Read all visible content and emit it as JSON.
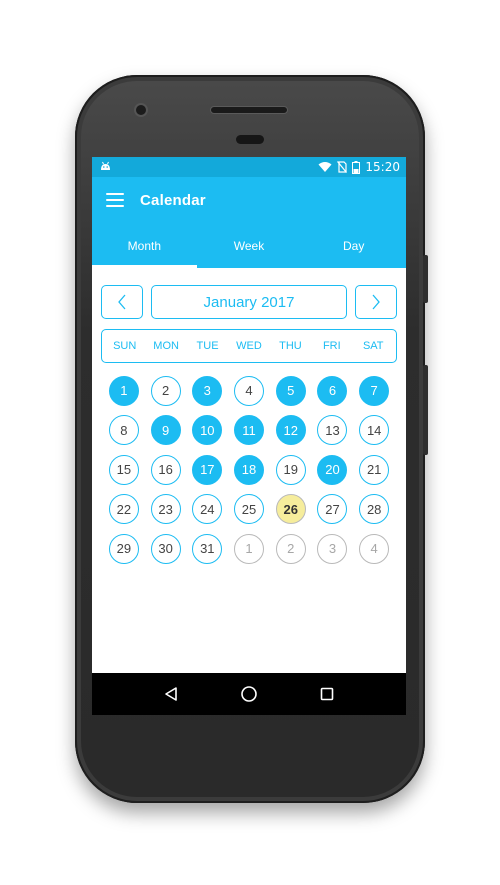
{
  "status_bar": {
    "time": "15:20",
    "icons": [
      "android-icon",
      "wifi-icon",
      "no-sim-icon",
      "battery-icon"
    ]
  },
  "app_bar": {
    "title": "Calendar",
    "menu_icon": "hamburger-menu-icon"
  },
  "tabs": [
    {
      "label": "Month",
      "active": true
    },
    {
      "label": "Week",
      "active": false
    },
    {
      "label": "Day",
      "active": false
    }
  ],
  "calendar": {
    "month_label": "January 2017",
    "prev_icon": "chevron-left-icon",
    "next_icon": "chevron-right-icon",
    "weekdays": [
      "SUN",
      "MON",
      "TUE",
      "WED",
      "THU",
      "FRI",
      "SAT"
    ],
    "weeks": [
      [
        {
          "d": "1",
          "s": "sel"
        },
        {
          "d": "2",
          "s": "normal"
        },
        {
          "d": "3",
          "s": "sel"
        },
        {
          "d": "4",
          "s": "normal"
        },
        {
          "d": "5",
          "s": "sel"
        },
        {
          "d": "6",
          "s": "sel"
        },
        {
          "d": "7",
          "s": "sel"
        }
      ],
      [
        {
          "d": "8",
          "s": "normal"
        },
        {
          "d": "9",
          "s": "sel"
        },
        {
          "d": "10",
          "s": "sel"
        },
        {
          "d": "11",
          "s": "sel"
        },
        {
          "d": "12",
          "s": "sel"
        },
        {
          "d": "13",
          "s": "normal"
        },
        {
          "d": "14",
          "s": "normal"
        }
      ],
      [
        {
          "d": "15",
          "s": "normal"
        },
        {
          "d": "16",
          "s": "normal"
        },
        {
          "d": "17",
          "s": "sel"
        },
        {
          "d": "18",
          "s": "sel"
        },
        {
          "d": "19",
          "s": "normal"
        },
        {
          "d": "20",
          "s": "sel"
        },
        {
          "d": "21",
          "s": "normal"
        }
      ],
      [
        {
          "d": "22",
          "s": "normal"
        },
        {
          "d": "23",
          "s": "normal"
        },
        {
          "d": "24",
          "s": "normal"
        },
        {
          "d": "25",
          "s": "normal"
        },
        {
          "d": "26",
          "s": "today"
        },
        {
          "d": "27",
          "s": "normal"
        },
        {
          "d": "28",
          "s": "normal"
        }
      ],
      [
        {
          "d": "29",
          "s": "normal"
        },
        {
          "d": "30",
          "s": "normal"
        },
        {
          "d": "31",
          "s": "normal"
        },
        {
          "d": "1",
          "s": "other"
        },
        {
          "d": "2",
          "s": "other"
        },
        {
          "d": "3",
          "s": "other"
        },
        {
          "d": "4",
          "s": "other"
        }
      ]
    ]
  },
  "nav_bar": {
    "icons": [
      "back-icon",
      "home-icon",
      "recents-icon"
    ]
  },
  "colors": {
    "accent": "#1cbcf2",
    "status_bar": "#13a9da",
    "today": "#f6ed9c",
    "other_month_border": "#b9b9b9"
  }
}
